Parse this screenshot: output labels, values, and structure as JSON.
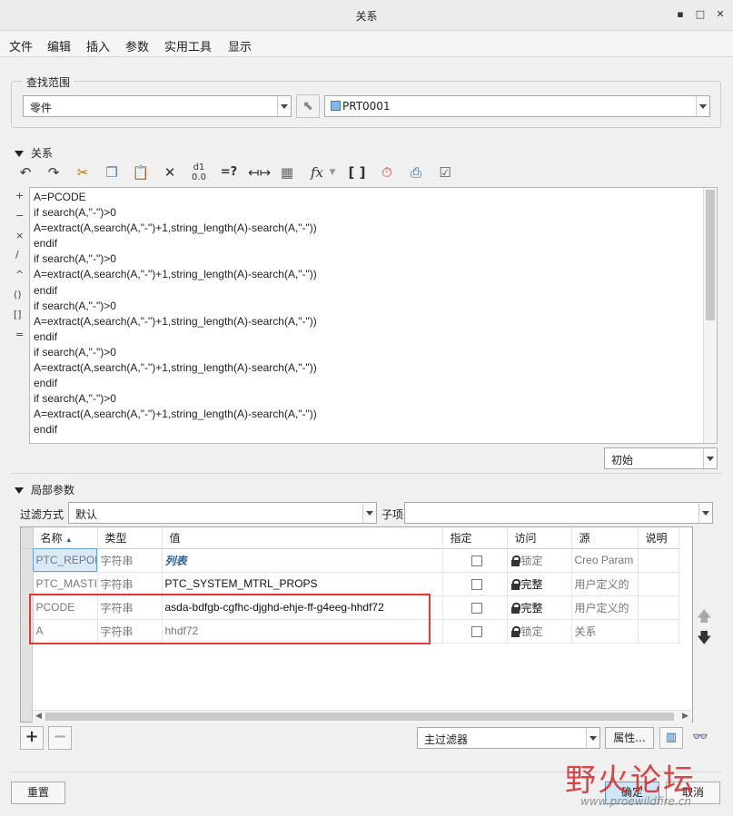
{
  "window": {
    "title": "关系",
    "min_icon": "minimize-icon",
    "max_icon": "maximize-icon",
    "close_icon": "close-icon"
  },
  "menu": [
    "文件",
    "编辑",
    "插入",
    "参数",
    "实用工具",
    "显示"
  ],
  "find_scope": {
    "group_title": "查找范围",
    "type_value": "零件",
    "model_value": "PRT0001"
  },
  "relations": {
    "section_title": "关系",
    "side_symbols": [
      "+",
      "−",
      "×",
      "/",
      "^",
      "()",
      "[]",
      "="
    ],
    "lines": [
      "A=PCODE",
      "if search(A,\"-\")>0",
      "A=extract(A,search(A,\"-\")+1,string_length(A)-search(A,\"-\"))",
      "endif",
      "if search(A,\"-\")>0",
      "A=extract(A,search(A,\"-\")+1,string_length(A)-search(A,\"-\"))",
      "endif",
      "if search(A,\"-\")>0",
      "A=extract(A,search(A,\"-\")+1,string_length(A)-search(A,\"-\"))",
      "endif",
      "if search(A,\"-\")>0",
      "A=extract(A,search(A,\"-\")+1,string_length(A)-search(A,\"-\"))",
      "endif",
      "if search(A,\"-\")>0",
      "A=extract(A,search(A,\"-\")+1,string_length(A)-search(A,\"-\"))",
      "endif"
    ],
    "initial_value": "初始"
  },
  "local_params": {
    "section_title": "局部参数",
    "filter_label": "过滤方式",
    "filter_value": "默认",
    "sub_label": "子项",
    "sub_value": "",
    "columns": [
      "名称",
      "类型",
      "值",
      "指定",
      "访问",
      "源",
      "说明"
    ],
    "rows": [
      {
        "name": "PTC_REPOI",
        "type": "字符串",
        "value": "列表",
        "access": "锁定",
        "source": "Creo Param",
        "desc": ""
      },
      {
        "name": "PTC_MASTI",
        "type": "字符串",
        "value": "PTC_SYSTEM_MTRL_PROPS",
        "access": "完整",
        "source": "用户定义的",
        "desc": ""
      },
      {
        "name": "PCODE",
        "type": "字符串",
        "value": "asda-bdfgb-cgfhc-djghd-ehje-ff-g4eeg-hhdf72",
        "access": "完整",
        "source": "用户定义的",
        "desc": ""
      },
      {
        "name": "A",
        "type": "字符串",
        "value": "hhdf72",
        "access": "锁定",
        "source": "关系",
        "desc": ""
      }
    ],
    "main_filter": "主过滤器",
    "properties_button": "属性..."
  },
  "buttons": {
    "reset": "重置",
    "ok": "确定",
    "cancel": "取消"
  },
  "watermark": {
    "brand": "野火论坛",
    "url": "www.proewildfire.cn"
  },
  "colors": {
    "highlight_box": "#e53935",
    "accent": "#2563a8"
  }
}
